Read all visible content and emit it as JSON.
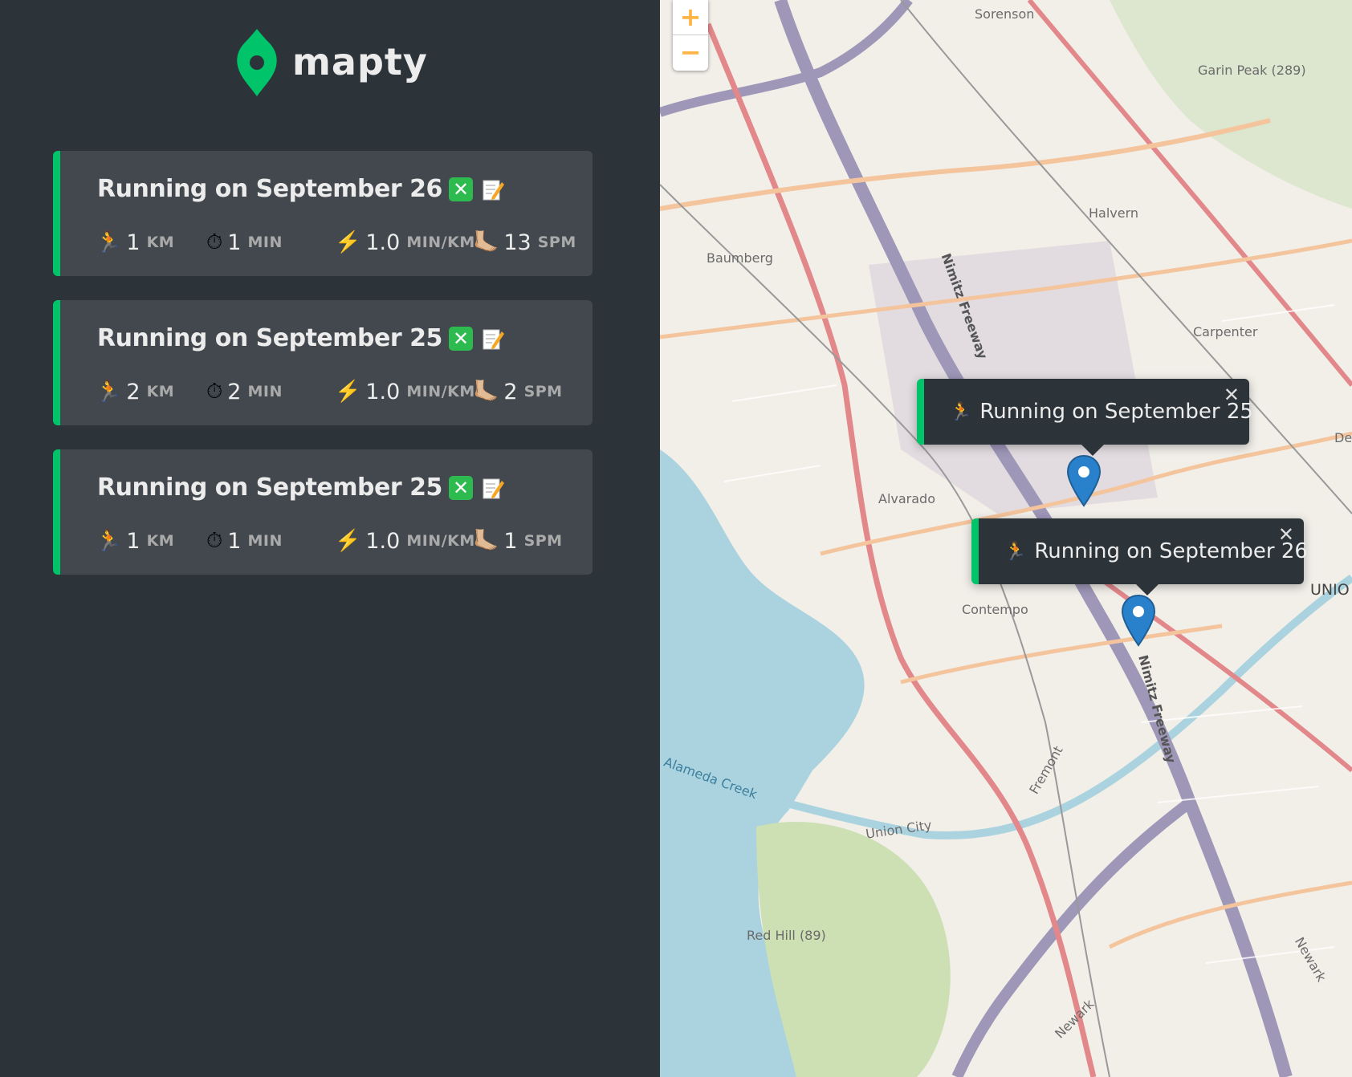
{
  "app": {
    "name": "mapty"
  },
  "colors": {
    "accent": "#00c46a",
    "sidebar_bg": "#2d3439",
    "card_bg": "#42484d",
    "zoom": "#ffb545"
  },
  "workouts": [
    {
      "title": "Running on September 26",
      "delete_icon": "❎",
      "edit_icon": "📝",
      "distance": {
        "icon": "🏃",
        "value": "1",
        "unit": "KM"
      },
      "duration": {
        "icon": "⏱",
        "value": "1",
        "unit": "MIN"
      },
      "pace": {
        "icon": "⚡️",
        "value": "1.0",
        "unit": "MIN/KM"
      },
      "cadence": {
        "icon": "🦶🏼",
        "value": "13",
        "unit": "SPM"
      }
    },
    {
      "title": "Running on September 25",
      "delete_icon": "❎",
      "edit_icon": "📝",
      "distance": {
        "icon": "🏃",
        "value": "2",
        "unit": "KM"
      },
      "duration": {
        "icon": "⏱",
        "value": "2",
        "unit": "MIN"
      },
      "pace": {
        "icon": "⚡️",
        "value": "1.0",
        "unit": "MIN/KM"
      },
      "cadence": {
        "icon": "🦶🏼",
        "value": "2",
        "unit": "SPM"
      }
    },
    {
      "title": "Running on September 25",
      "delete_icon": "❎",
      "edit_icon": "📝",
      "distance": {
        "icon": "🏃",
        "value": "1",
        "unit": "KM"
      },
      "duration": {
        "icon": "⏱",
        "value": "1",
        "unit": "MIN"
      },
      "pace": {
        "icon": "⚡️",
        "value": "1.0",
        "unit": "MIN/KM"
      },
      "cadence": {
        "icon": "🦶🏼",
        "value": "1",
        "unit": "SPM"
      }
    }
  ],
  "map": {
    "zoom_in": "+",
    "zoom_out": "−",
    "popups": [
      {
        "icon": "🏃",
        "text": "Running on September 25",
        "close": "✕"
      },
      {
        "icon": "🏃",
        "text": "Running on September 26",
        "close": "✕"
      }
    ],
    "labels": [
      "Sorenson",
      "Garin Peak (289)",
      "Halvern",
      "Baumberg",
      "Nimitz Freeway",
      "Carpenter",
      "Alvarado",
      "Contempo",
      "UNIO",
      "De",
      "Fremont",
      "Alameda Creek",
      "Union City",
      "Red Hill (89)",
      "Newark",
      "Newark",
      "Nimitz Freeway"
    ]
  }
}
